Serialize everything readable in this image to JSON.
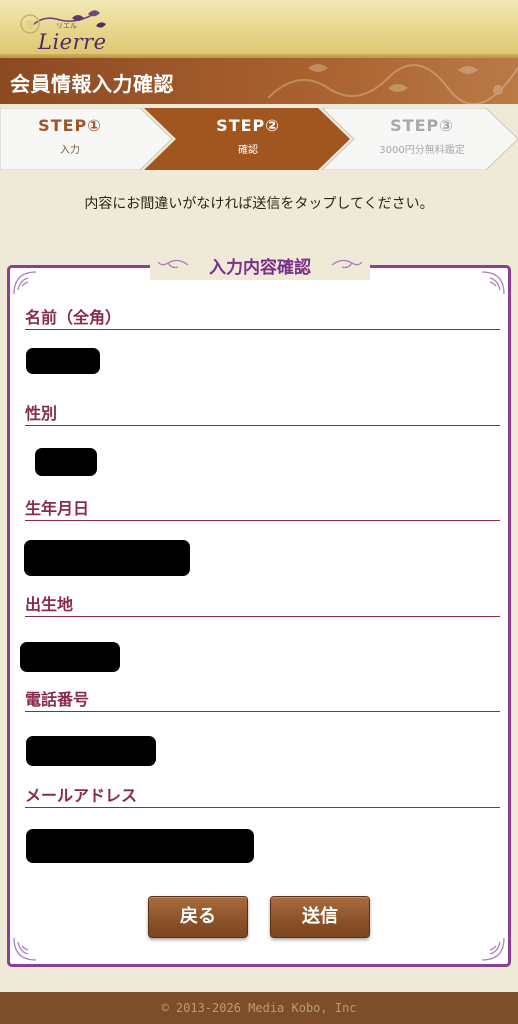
{
  "header": {
    "logo_text": "Lierre",
    "logo_kana": "リエル"
  },
  "title_bar": {
    "title": "会員情報入力確認"
  },
  "steps": [
    {
      "number": "STEP①",
      "label": "入力",
      "state": "done"
    },
    {
      "number": "STEP②",
      "label": "確認",
      "state": "current"
    },
    {
      "number": "STEP③",
      "label": "3000円分無料鑑定",
      "state": "upcoming"
    }
  ],
  "instruction": "内容にお間違いがなければ送信をタップしてください。",
  "confirm": {
    "heading": "入力内容確認",
    "fields": [
      {
        "label": "名前（全角）",
        "value_redacted": true
      },
      {
        "label": "性別",
        "value_redacted": true
      },
      {
        "label": "生年月日",
        "value_redacted": true
      },
      {
        "label": "出生地",
        "value_redacted": true
      },
      {
        "label": "電話番号",
        "value_redacted": true
      },
      {
        "label": "メールアドレス",
        "value_redacted": true
      }
    ]
  },
  "buttons": {
    "back_label": "戻る",
    "send_label": "送信"
  },
  "footer": {
    "copyright": "© 2013-2026 Media Kobo, Inc"
  },
  "colors": {
    "accent_brown": "#8b5229",
    "panel_border_purple": "#8a3f93",
    "label_maroon": "#8a2a4d",
    "background": "#efe9d8"
  }
}
